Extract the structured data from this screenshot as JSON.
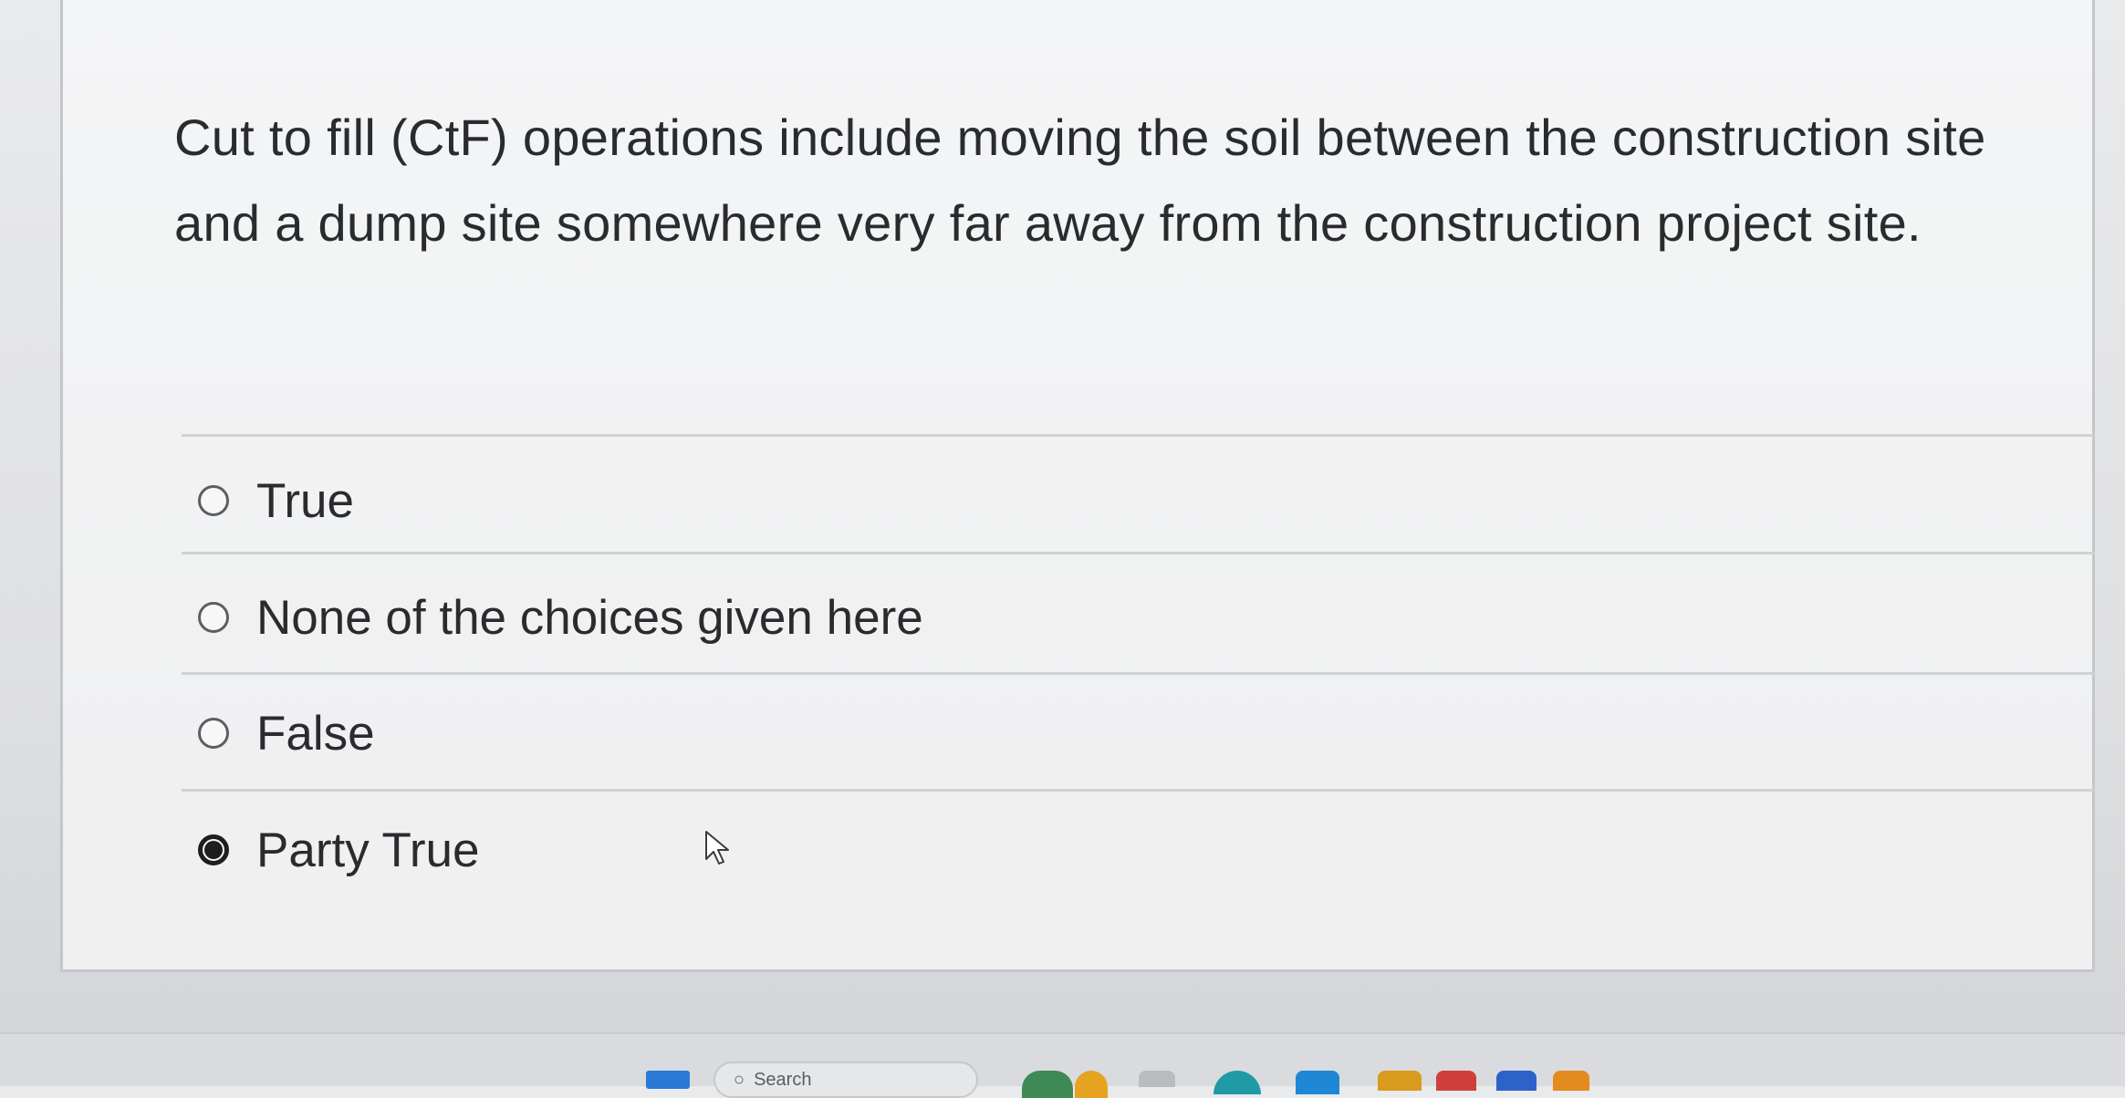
{
  "question": {
    "text": "Cut to fill (CtF) operations include moving the soil between the construction site and a dump site somewhere very far away from the construction project site."
  },
  "options": [
    {
      "label": "True",
      "selected": false
    },
    {
      "label": "None of the choices given here",
      "selected": false
    },
    {
      "label": "False",
      "selected": false
    },
    {
      "label": "Party True",
      "selected": true
    }
  ],
  "taskbar": {
    "search_text": "Search"
  },
  "colors": {
    "card_background": "#f0f0f1",
    "text": "#2a2b2e",
    "divider": "#cfd2d5",
    "radio_border": "#5b5e63",
    "radio_selected": "#1d1e20"
  }
}
